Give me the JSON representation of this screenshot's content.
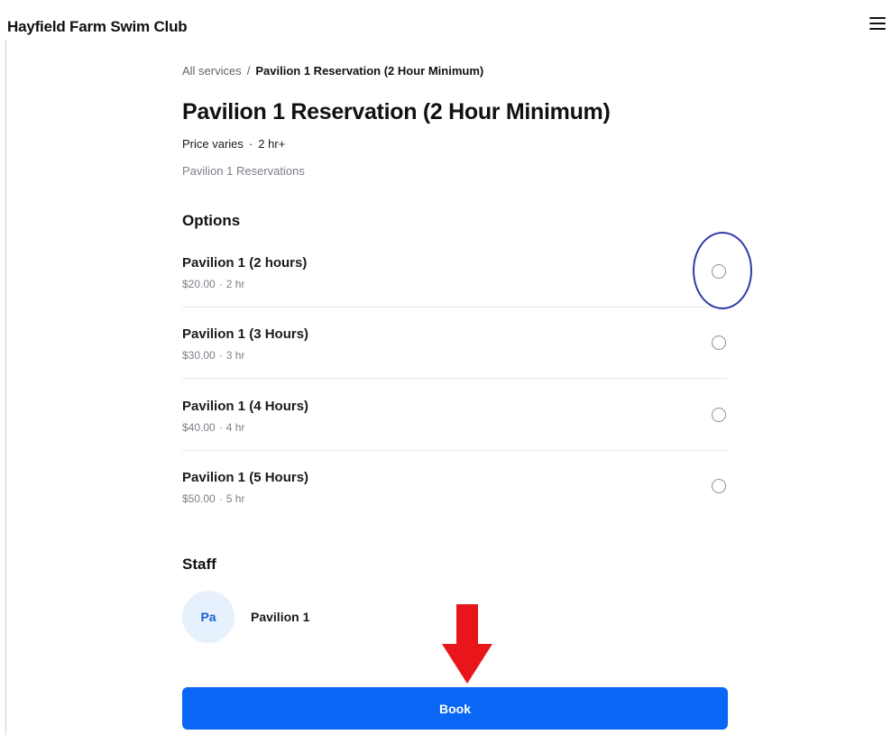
{
  "header": {
    "site_title": "Hayfield Farm Swim Club",
    "menu_icon": "hamburger-menu-icon"
  },
  "breadcrumb": {
    "link_label": "All services",
    "separator": "/",
    "current": "Pavilion 1 Reservation (2 Hour Minimum)"
  },
  "service": {
    "title": "Pavilion 1 Reservation (2 Hour Minimum)",
    "price": "Price varies",
    "separator": "·",
    "duration": "2 hr+",
    "category": "Pavilion 1 Reservations"
  },
  "options": {
    "heading": "Options",
    "items": [
      {
        "name": "Pavilion 1 (2 hours)",
        "price": "$20.00",
        "separator": "·",
        "duration": "2 hr",
        "selected": false
      },
      {
        "name": "Pavilion 1 (3 Hours)",
        "price": "$30.00",
        "separator": "·",
        "duration": "3 hr",
        "selected": false
      },
      {
        "name": "Pavilion 1 (4 Hours)",
        "price": "$40.00",
        "separator": "·",
        "duration": "4 hr",
        "selected": false
      },
      {
        "name": "Pavilion 1 (5 Hours)",
        "price": "$50.00",
        "separator": "·",
        "duration": "5 hr",
        "selected": false
      }
    ]
  },
  "staff": {
    "heading": "Staff",
    "avatar_initials": "Pa",
    "name": "Pavilion 1"
  },
  "actions": {
    "book_label": "Book"
  },
  "colors": {
    "primary_button": "#0a66f5",
    "avatar_bg": "#e7f0fd",
    "avatar_text": "#1a5fd6",
    "annotation_circle": "#2f3aa6",
    "annotation_arrow": "#e8151b"
  }
}
